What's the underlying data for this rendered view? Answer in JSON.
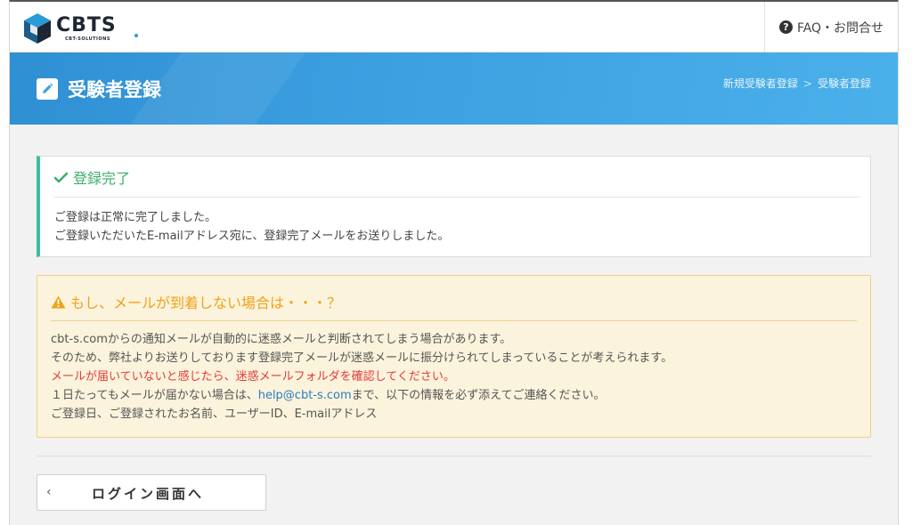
{
  "header": {
    "logo_text": "CBTS",
    "logo_sub": "CBT-SOLUTIONS",
    "faq_label": "FAQ・お問合せ"
  },
  "banner": {
    "title": "受験者登録",
    "breadcrumb": [
      "新規受験者登録",
      "受験者登録"
    ],
    "breadcrumb_sep": ">"
  },
  "success": {
    "title": "登録完了",
    "lines": [
      "ご登録は正常に完了しました。",
      "ご登録いただいたE-mailアドレス宛に、登録完了メールをお送りしました。"
    ]
  },
  "warning": {
    "title": "もし、メールが到着しない場合は・・・？",
    "line1": "cbt-s.comからの通知メールが自動的に迷惑メールと判断されてしまう場合があります。",
    "line2": "そのため、弊社よりお送りしております登録完了メールが迷惑メールに振分けられてしまっていることが考えられます。",
    "line3_red": "メールが届いていないと感じたら、迷惑メールフォルダを確認してください。",
    "line4_before": "１日たってもメールが届かない場合は、",
    "line4_email": "help@cbt-s.com",
    "line4_after": "まで、以下の情報を必ず添えてご連絡ください。",
    "line5": "ご登録日、ご登録されたお名前、ユーザーID、E-mailアドレス"
  },
  "back_button": {
    "chevron": "‹",
    "label": "ログイン画面へ"
  },
  "colors": {
    "banner": "#3c9fe0",
    "success_accent": "#3bbf9b",
    "success_title": "#3bae6a",
    "warning_title": "#f0a21a",
    "warning_bg": "#fcf3dc",
    "alert_red": "#e23b3b",
    "link": "#2a7ec2"
  },
  "icons": {
    "logo": "cube-logo-icon",
    "faq": "question-circle-icon",
    "banner": "edit-pencil-icon",
    "success": "check-icon",
    "warning": "warning-triangle-icon"
  }
}
